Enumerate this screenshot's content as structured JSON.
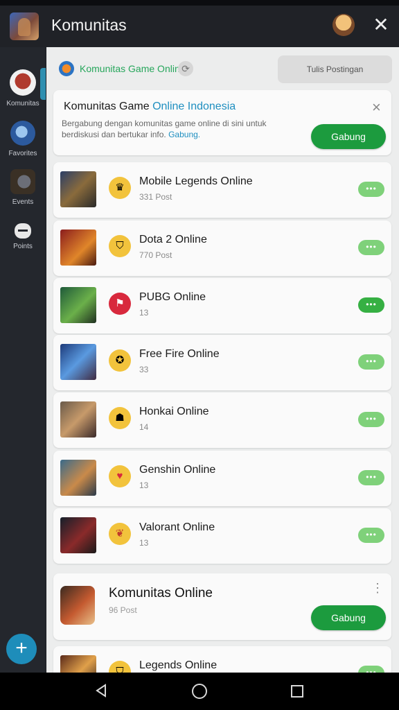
{
  "app": {
    "title": "Komunitas"
  },
  "sidebar": {
    "items": [
      {
        "label": "Komunitas",
        "icon": "community-icon"
      },
      {
        "label": "Favorites",
        "icon": "favorites-icon"
      },
      {
        "label": "Events",
        "icon": "events-icon"
      },
      {
        "label": "Points",
        "icon": "points-icon"
      }
    ],
    "fab_label": "+"
  },
  "community": {
    "name": "Komunitas Game Online",
    "compose_label": "Tulis Postingan"
  },
  "banner": {
    "title_plain": "Komunitas Game ",
    "title_accent": "Online Indonesia",
    "desc_plain": "Bergabung dengan komunitas game online di sini untuk berdiskusi dan bertukar info. ",
    "desc_link": "Gabung.",
    "close_label": "×",
    "button_label": "Gabung"
  },
  "rows": [
    {
      "title": "Mobile Legends Online",
      "sub": "331 Post",
      "more": "•••"
    },
    {
      "title": "Dota 2 Online",
      "sub": "770 Post",
      "more": "•••"
    },
    {
      "title": "PUBG Online",
      "sub": "13",
      "more": "•••"
    },
    {
      "title": "Free Fire Online",
      "sub": "33",
      "more": "•••"
    },
    {
      "title": "Honkai Online",
      "sub": "14",
      "more": "•••"
    },
    {
      "title": "Genshin Online",
      "sub": "13",
      "more": "•••"
    },
    {
      "title": "Valorant Online",
      "sub": "13",
      "more": "•••"
    },
    {
      "title": "Legends Online",
      "sub": "",
      "more": "•••"
    }
  ],
  "featured": {
    "title": "Komunitas Online",
    "sub": "96 Post",
    "button_label": "Gabung",
    "kebab": "⋮"
  },
  "colors": {
    "accent_green": "#1c9b3e",
    "accent_blue": "#1f8fc0",
    "sidebar_bg": "#24272d"
  }
}
